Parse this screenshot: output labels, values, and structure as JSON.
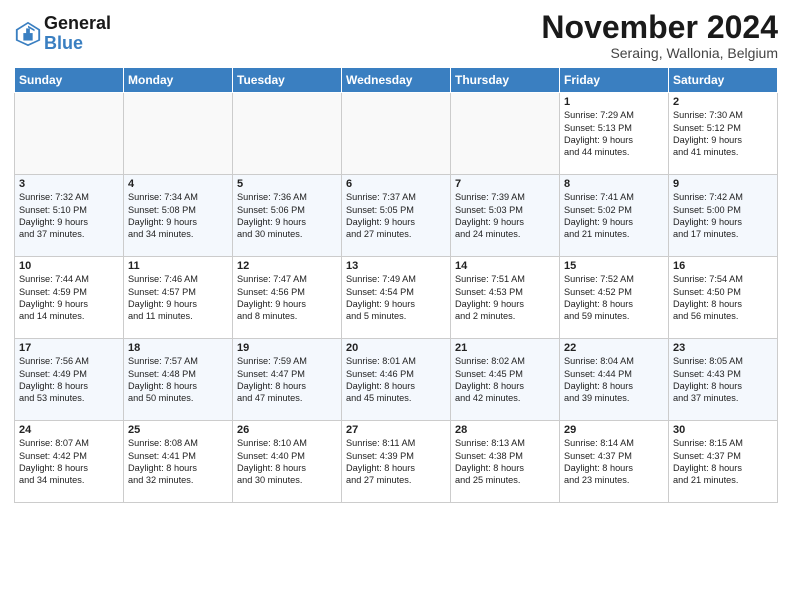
{
  "logo": {
    "text_general": "General",
    "text_blue": "Blue"
  },
  "header": {
    "month": "November 2024",
    "location": "Seraing, Wallonia, Belgium"
  },
  "days_of_week": [
    "Sunday",
    "Monday",
    "Tuesday",
    "Wednesday",
    "Thursday",
    "Friday",
    "Saturday"
  ],
  "weeks": [
    [
      {
        "day": "",
        "info": ""
      },
      {
        "day": "",
        "info": ""
      },
      {
        "day": "",
        "info": ""
      },
      {
        "day": "",
        "info": ""
      },
      {
        "day": "",
        "info": ""
      },
      {
        "day": "1",
        "info": "Sunrise: 7:29 AM\nSunset: 5:13 PM\nDaylight: 9 hours\nand 44 minutes."
      },
      {
        "day": "2",
        "info": "Sunrise: 7:30 AM\nSunset: 5:12 PM\nDaylight: 9 hours\nand 41 minutes."
      }
    ],
    [
      {
        "day": "3",
        "info": "Sunrise: 7:32 AM\nSunset: 5:10 PM\nDaylight: 9 hours\nand 37 minutes."
      },
      {
        "day": "4",
        "info": "Sunrise: 7:34 AM\nSunset: 5:08 PM\nDaylight: 9 hours\nand 34 minutes."
      },
      {
        "day": "5",
        "info": "Sunrise: 7:36 AM\nSunset: 5:06 PM\nDaylight: 9 hours\nand 30 minutes."
      },
      {
        "day": "6",
        "info": "Sunrise: 7:37 AM\nSunset: 5:05 PM\nDaylight: 9 hours\nand 27 minutes."
      },
      {
        "day": "7",
        "info": "Sunrise: 7:39 AM\nSunset: 5:03 PM\nDaylight: 9 hours\nand 24 minutes."
      },
      {
        "day": "8",
        "info": "Sunrise: 7:41 AM\nSunset: 5:02 PM\nDaylight: 9 hours\nand 21 minutes."
      },
      {
        "day": "9",
        "info": "Sunrise: 7:42 AM\nSunset: 5:00 PM\nDaylight: 9 hours\nand 17 minutes."
      }
    ],
    [
      {
        "day": "10",
        "info": "Sunrise: 7:44 AM\nSunset: 4:59 PM\nDaylight: 9 hours\nand 14 minutes."
      },
      {
        "day": "11",
        "info": "Sunrise: 7:46 AM\nSunset: 4:57 PM\nDaylight: 9 hours\nand 11 minutes."
      },
      {
        "day": "12",
        "info": "Sunrise: 7:47 AM\nSunset: 4:56 PM\nDaylight: 9 hours\nand 8 minutes."
      },
      {
        "day": "13",
        "info": "Sunrise: 7:49 AM\nSunset: 4:54 PM\nDaylight: 9 hours\nand 5 minutes."
      },
      {
        "day": "14",
        "info": "Sunrise: 7:51 AM\nSunset: 4:53 PM\nDaylight: 9 hours\nand 2 minutes."
      },
      {
        "day": "15",
        "info": "Sunrise: 7:52 AM\nSunset: 4:52 PM\nDaylight: 8 hours\nand 59 minutes."
      },
      {
        "day": "16",
        "info": "Sunrise: 7:54 AM\nSunset: 4:50 PM\nDaylight: 8 hours\nand 56 minutes."
      }
    ],
    [
      {
        "day": "17",
        "info": "Sunrise: 7:56 AM\nSunset: 4:49 PM\nDaylight: 8 hours\nand 53 minutes."
      },
      {
        "day": "18",
        "info": "Sunrise: 7:57 AM\nSunset: 4:48 PM\nDaylight: 8 hours\nand 50 minutes."
      },
      {
        "day": "19",
        "info": "Sunrise: 7:59 AM\nSunset: 4:47 PM\nDaylight: 8 hours\nand 47 minutes."
      },
      {
        "day": "20",
        "info": "Sunrise: 8:01 AM\nSunset: 4:46 PM\nDaylight: 8 hours\nand 45 minutes."
      },
      {
        "day": "21",
        "info": "Sunrise: 8:02 AM\nSunset: 4:45 PM\nDaylight: 8 hours\nand 42 minutes."
      },
      {
        "day": "22",
        "info": "Sunrise: 8:04 AM\nSunset: 4:44 PM\nDaylight: 8 hours\nand 39 minutes."
      },
      {
        "day": "23",
        "info": "Sunrise: 8:05 AM\nSunset: 4:43 PM\nDaylight: 8 hours\nand 37 minutes."
      }
    ],
    [
      {
        "day": "24",
        "info": "Sunrise: 8:07 AM\nSunset: 4:42 PM\nDaylight: 8 hours\nand 34 minutes."
      },
      {
        "day": "25",
        "info": "Sunrise: 8:08 AM\nSunset: 4:41 PM\nDaylight: 8 hours\nand 32 minutes."
      },
      {
        "day": "26",
        "info": "Sunrise: 8:10 AM\nSunset: 4:40 PM\nDaylight: 8 hours\nand 30 minutes."
      },
      {
        "day": "27",
        "info": "Sunrise: 8:11 AM\nSunset: 4:39 PM\nDaylight: 8 hours\nand 27 minutes."
      },
      {
        "day": "28",
        "info": "Sunrise: 8:13 AM\nSunset: 4:38 PM\nDaylight: 8 hours\nand 25 minutes."
      },
      {
        "day": "29",
        "info": "Sunrise: 8:14 AM\nSunset: 4:37 PM\nDaylight: 8 hours\nand 23 minutes."
      },
      {
        "day": "30",
        "info": "Sunrise: 8:15 AM\nSunset: 4:37 PM\nDaylight: 8 hours\nand 21 minutes."
      }
    ]
  ]
}
